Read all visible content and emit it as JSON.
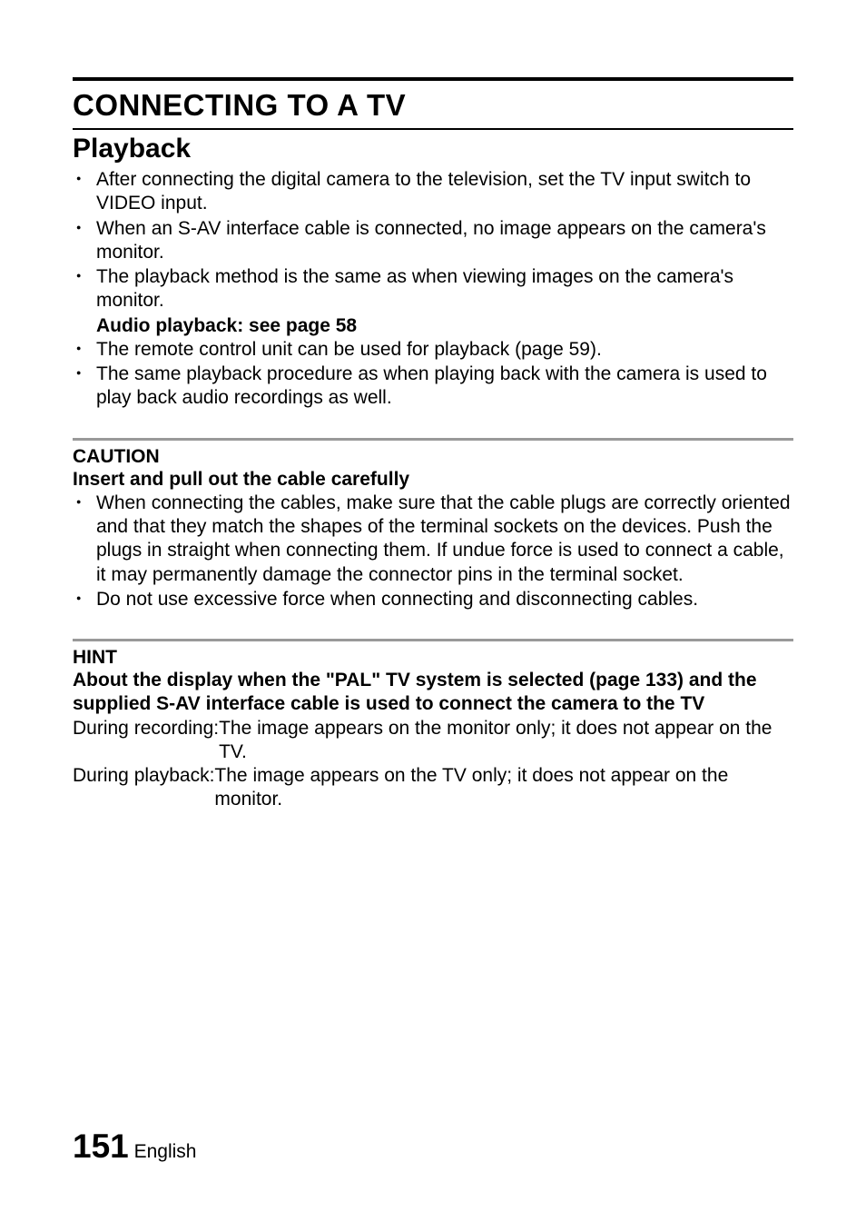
{
  "title": "CONNECTING TO A TV",
  "section": {
    "heading": "Playback",
    "bullets": [
      "After connecting the digital camera to the television, set the TV input switch to VIDEO input.",
      "When an S-AV interface cable is connected, no image appears on the camera's monitor.",
      "The playback method is the same as when viewing images on the camera's monitor."
    ],
    "audio_line": "Audio playback: see page 58",
    "bullets2": [
      "The remote control unit can be used for playback (page 59).",
      "The same playback procedure as when playing back with the camera is used to play back audio recordings as well."
    ]
  },
  "caution": {
    "label": "CAUTION",
    "heading": "Insert and pull out the cable carefully",
    "bullets": [
      "When connecting the cables, make sure that the cable plugs are correctly oriented and that they match the shapes of the terminal sockets on the devices. Push the plugs in straight when connecting them. If undue force is used to connect a cable, it may permanently damage the connector pins in the terminal socket.",
      "Do not use excessive force when connecting and disconnecting cables."
    ]
  },
  "hint": {
    "label": "HINT",
    "heading": "About the display when the \"PAL\" TV system is selected (page 133) and the supplied S-AV interface cable is used to connect the camera to the TV",
    "rows": [
      {
        "key": "During recording:",
        "val": "The image appears on the monitor only; it does not appear on the TV."
      },
      {
        "key": "During playback: ",
        "val": "The image appears on the TV only; it does not appear on the monitor."
      }
    ]
  },
  "footer": {
    "page": "151",
    "lang": "English"
  }
}
